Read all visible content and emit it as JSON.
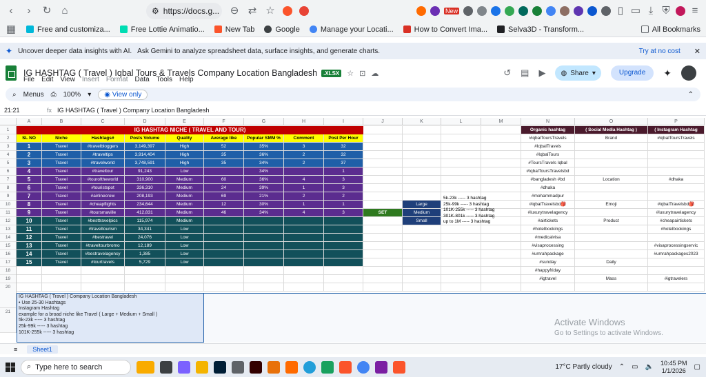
{
  "browser": {
    "url": "https://docs.g...",
    "bookmarks": [
      "Free and customiza...",
      "Free Lottie Animatio...",
      "New Tab",
      "Google",
      "Manage your Locati...",
      "How to Convert Ima...",
      "Selva3D - Transform..."
    ],
    "all_bookmarks": "All Bookmarks",
    "new_badge": "New"
  },
  "banner": {
    "text": "Uncover deeper data insights with AI.",
    "sub": "Ask Gemini to analyze spreadsheet data, surface insights, and generate charts.",
    "try": "Try at no cost"
  },
  "sheet": {
    "title": "IG HASHTAG ( Travel ) Iqbal Tours & Travels Company Location Bangladesh",
    "badge": ".XLSX",
    "menus": [
      "File",
      "Edit",
      "View",
      "Insert",
      "Format",
      "Data",
      "Tools",
      "Help"
    ],
    "share": "Share",
    "upgrade": "Upgrade",
    "toolbar_menus": "Menus",
    "zoom": "100%",
    "view_only": "View only",
    "cell_ref": "21:21",
    "formula": "IG HASHTAG ( Travel ) Company Location Bangladesh",
    "tab": "Sheet1"
  },
  "columns": [
    "A",
    "B",
    "C",
    "D",
    "E",
    "F",
    "G",
    "H",
    "I",
    "J",
    "K",
    "L",
    "M",
    "N",
    "O",
    "P"
  ],
  "rows": [
    "1",
    "2",
    "3",
    "4",
    "5",
    "6",
    "7",
    "8",
    "9",
    "10",
    "11",
    "12",
    "13",
    "14",
    "15",
    "16",
    "17",
    "18",
    "19",
    "20",
    "21"
  ],
  "table": {
    "title": "IG HASHTAG NICHE ( TRAVEL AND TOUR)",
    "headers": [
      "SL NO",
      "Niche",
      "Hashtags#",
      "Posts Volume",
      "Quality",
      "Average like",
      "Popular SMM %",
      "Comment",
      "Post Per Hour"
    ],
    "rows": [
      [
        "1",
        "Travel",
        "#travelbloggers",
        "3,149,397",
        "High",
        "52",
        "35%",
        "3",
        "32"
      ],
      [
        "2",
        "Travel",
        "#traveltips",
        "3,914,404",
        "High",
        "35",
        "36%",
        "2",
        "32"
      ],
      [
        "3",
        "Travel",
        "#travelworld",
        "3,748,591",
        "High",
        "35",
        "34%",
        "2",
        "37"
      ],
      [
        "4",
        "Travel",
        "#traveltour",
        "91,243",
        "Low",
        "",
        "34%",
        "",
        "1"
      ],
      [
        "5",
        "Travel",
        "#touroftheworld",
        "310,900",
        "Medium",
        "60",
        "36%",
        "4",
        "3"
      ],
      [
        "6",
        "Travel",
        "#touristspot",
        "336,310",
        "Medium",
        "24",
        "39%",
        "1",
        "3"
      ],
      [
        "7",
        "Travel",
        "#airlinecrew",
        "208,193",
        "Medium",
        "69",
        "21%",
        "2",
        "2"
      ],
      [
        "8",
        "Travel",
        "#cheapflights",
        "234,644",
        "Medium",
        "12",
        "30%",
        "1",
        "1"
      ],
      [
        "9",
        "Travel",
        "#toursmaville",
        "412,831",
        "Medium",
        "46",
        "34%",
        "4",
        "3"
      ],
      [
        "10",
        "Travel",
        "#besttravelpics",
        "115,974",
        "Medium",
        "",
        "",
        "",
        ""
      ],
      [
        "11",
        "Travel",
        "#traveltourism",
        "34,341",
        "Low",
        "",
        "",
        "",
        ""
      ],
      [
        "12",
        "Travel",
        "#bestravel",
        "24,076",
        "Low",
        "",
        "",
        "",
        ""
      ],
      [
        "13",
        "Travel",
        "#traveltourbromo",
        "12,189",
        "Low",
        "",
        "",
        "",
        ""
      ],
      [
        "14",
        "Travel",
        "#bestravelagency",
        "1,385",
        "Low",
        "",
        "",
        "",
        ""
      ],
      [
        "15",
        "Travel",
        "#tourtravels",
        "5,729",
        "Low",
        "",
        "",
        "",
        ""
      ]
    ]
  },
  "set_label": "SET",
  "levels": [
    "Large",
    "Medium",
    "Small"
  ],
  "level_notes": [
    "5k-23k  -----    3 hashtag",
    "25k-99k  -----  3 hashtag",
    "101K-255k  -----  3 hashtag",
    "301K-801k  -----  3 hashtag",
    "up to 1M  -----  3 hashtag"
  ],
  "right_headers": [
    "Organic hashtag",
    "( Social Media Hashtag )",
    "( Instagram Hashtag"
  ],
  "right_rows": [
    [
      "#iqbalToursTravels",
      "Brand",
      "#iqbalToursTravels"
    ],
    [
      "#IqbalTravels",
      "",
      ""
    ],
    [
      "#IqbalTours",
      "",
      ""
    ],
    [
      "#ToursTravels Iqbal",
      "",
      ""
    ],
    [
      "#IqbalToursTravelsbd",
      "",
      ""
    ],
    [
      "#bangladesh #bd",
      "Location",
      "#dhaka"
    ],
    [
      "#dhaka",
      "",
      ""
    ],
    [
      "#mohammadpur",
      "",
      ""
    ],
    [
      "#iqbalTravelsbd🎒",
      "Emoji",
      "#iqbalTravelsbd🎒"
    ],
    [
      "#luxurytravelagency",
      "",
      "#luxurytravelagency"
    ],
    [
      "#airtickets",
      "Product",
      "#cheapairtickets"
    ],
    [
      "#hotelbookings",
      "",
      "#hotelbookings"
    ],
    [
      "#medicalvisa",
      "",
      ""
    ],
    [
      "#visaprocessing",
      "",
      "#visaprocessingservic"
    ],
    [
      "#umrahpackage",
      "",
      "#umrahpackages2023"
    ],
    [
      "#sunday",
      "Daily",
      ""
    ],
    [
      "#happyfriday",
      "",
      ""
    ],
    [
      "#igtravel",
      "Mass",
      "#igtravelers"
    ]
  ],
  "notes": [
    "IG HASHTAG ( Travel ) Company Location Bangladesh",
    "• Use 25-30 Hashtags",
    "   Instagram Hashtag",
    "example for a broad niche like Travel ( Large + Medium + Small )",
    "5k-23k  -----    3 hashtag",
    "25k-99k  -----    3 hashtag",
    "101K-255k  -----   3 hashtag"
  ],
  "watermark": {
    "title": "Activate Windows",
    "sub": "Go to Settings to activate Windows."
  },
  "taskbar": {
    "search": "Type here to search",
    "weather": "17°C  Partly cloudy",
    "time": "10:45 PM",
    "date": "1/1/2026"
  },
  "colors": {
    "title_red": "#c00000",
    "header_yellow": "#ffff00",
    "blue": "#1f5fa8",
    "purple": "#5b2c8f",
    "teal": "#12505a"
  }
}
